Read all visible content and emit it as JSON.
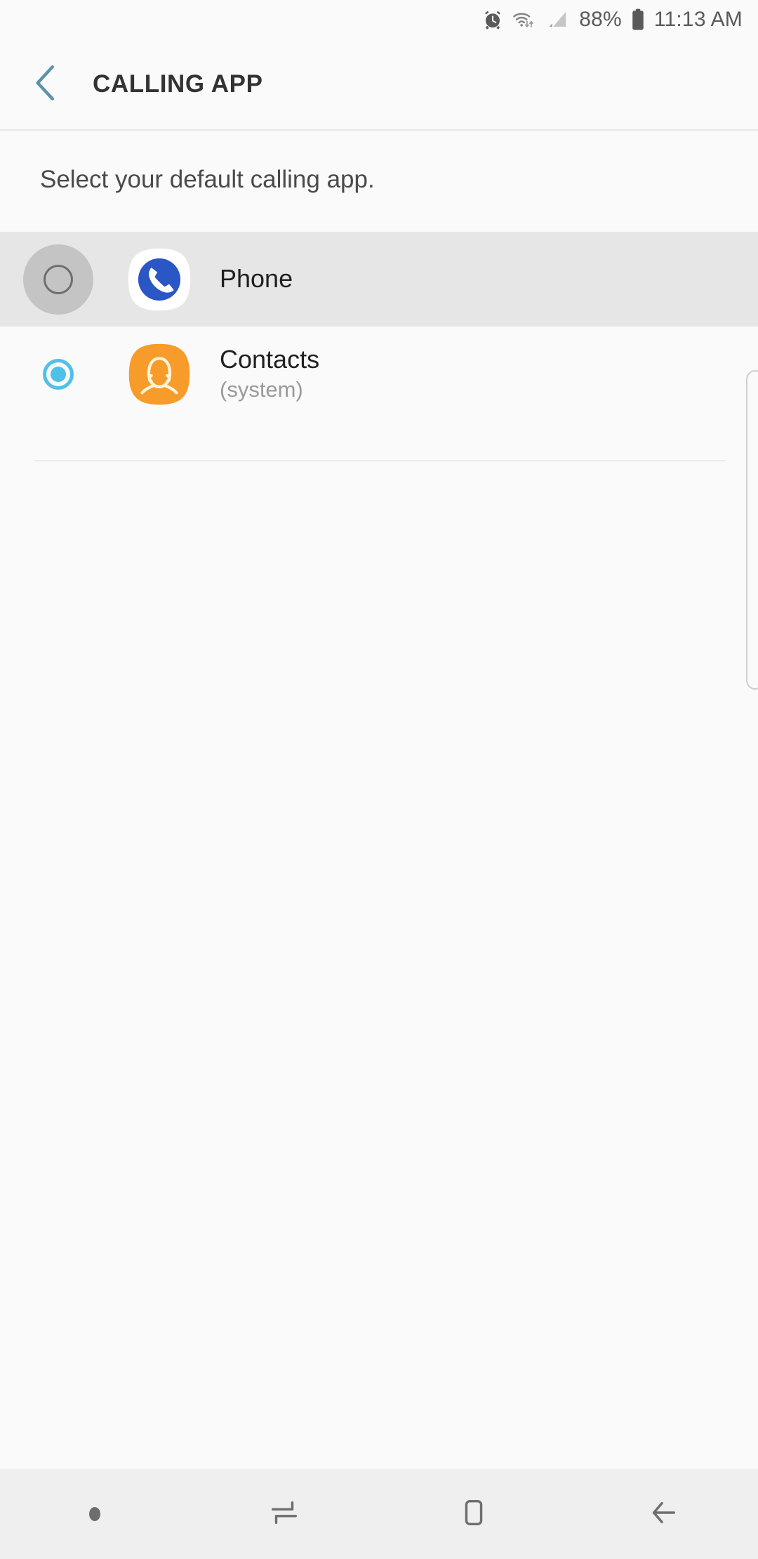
{
  "status_bar": {
    "alarm_icon": "alarm-clock-icon",
    "wifi_icon": "wifi-icon",
    "signal_icon": "cellular-signal-icon",
    "battery_percent": "88%",
    "battery_icon": "battery-full-icon",
    "time": "11:13 AM"
  },
  "header": {
    "back_icon": "back-chevron-icon",
    "title": "CALLING APP",
    "back_icon_color": "#5b93a8"
  },
  "content": {
    "description": "Select your default calling app."
  },
  "apps": [
    {
      "name": "Phone",
      "subtitle": "",
      "selected": false,
      "pressed": true,
      "icon_name": "phone-app-icon",
      "icon_bg": "#ffffff",
      "icon_fg": "#2b56c6"
    },
    {
      "name": "Contacts",
      "subtitle": "(system)",
      "selected": true,
      "pressed": false,
      "icon_name": "contacts-app-icon",
      "icon_bg": "#f79c2a",
      "icon_fg": "#fff4dc"
    }
  ],
  "colors": {
    "accent": "#4fc0e8",
    "page_background": "#fafafa",
    "pressed_row": "#e6e6e6",
    "nav_background": "#efefef"
  },
  "nav_bar": {
    "buttons": [
      {
        "icon_name": "nav-hide-dot-icon",
        "label": ""
      },
      {
        "icon_name": "recents-icon",
        "label": ""
      },
      {
        "icon_name": "home-icon",
        "label": ""
      },
      {
        "icon_name": "back-arrow-icon",
        "label": ""
      }
    ]
  }
}
